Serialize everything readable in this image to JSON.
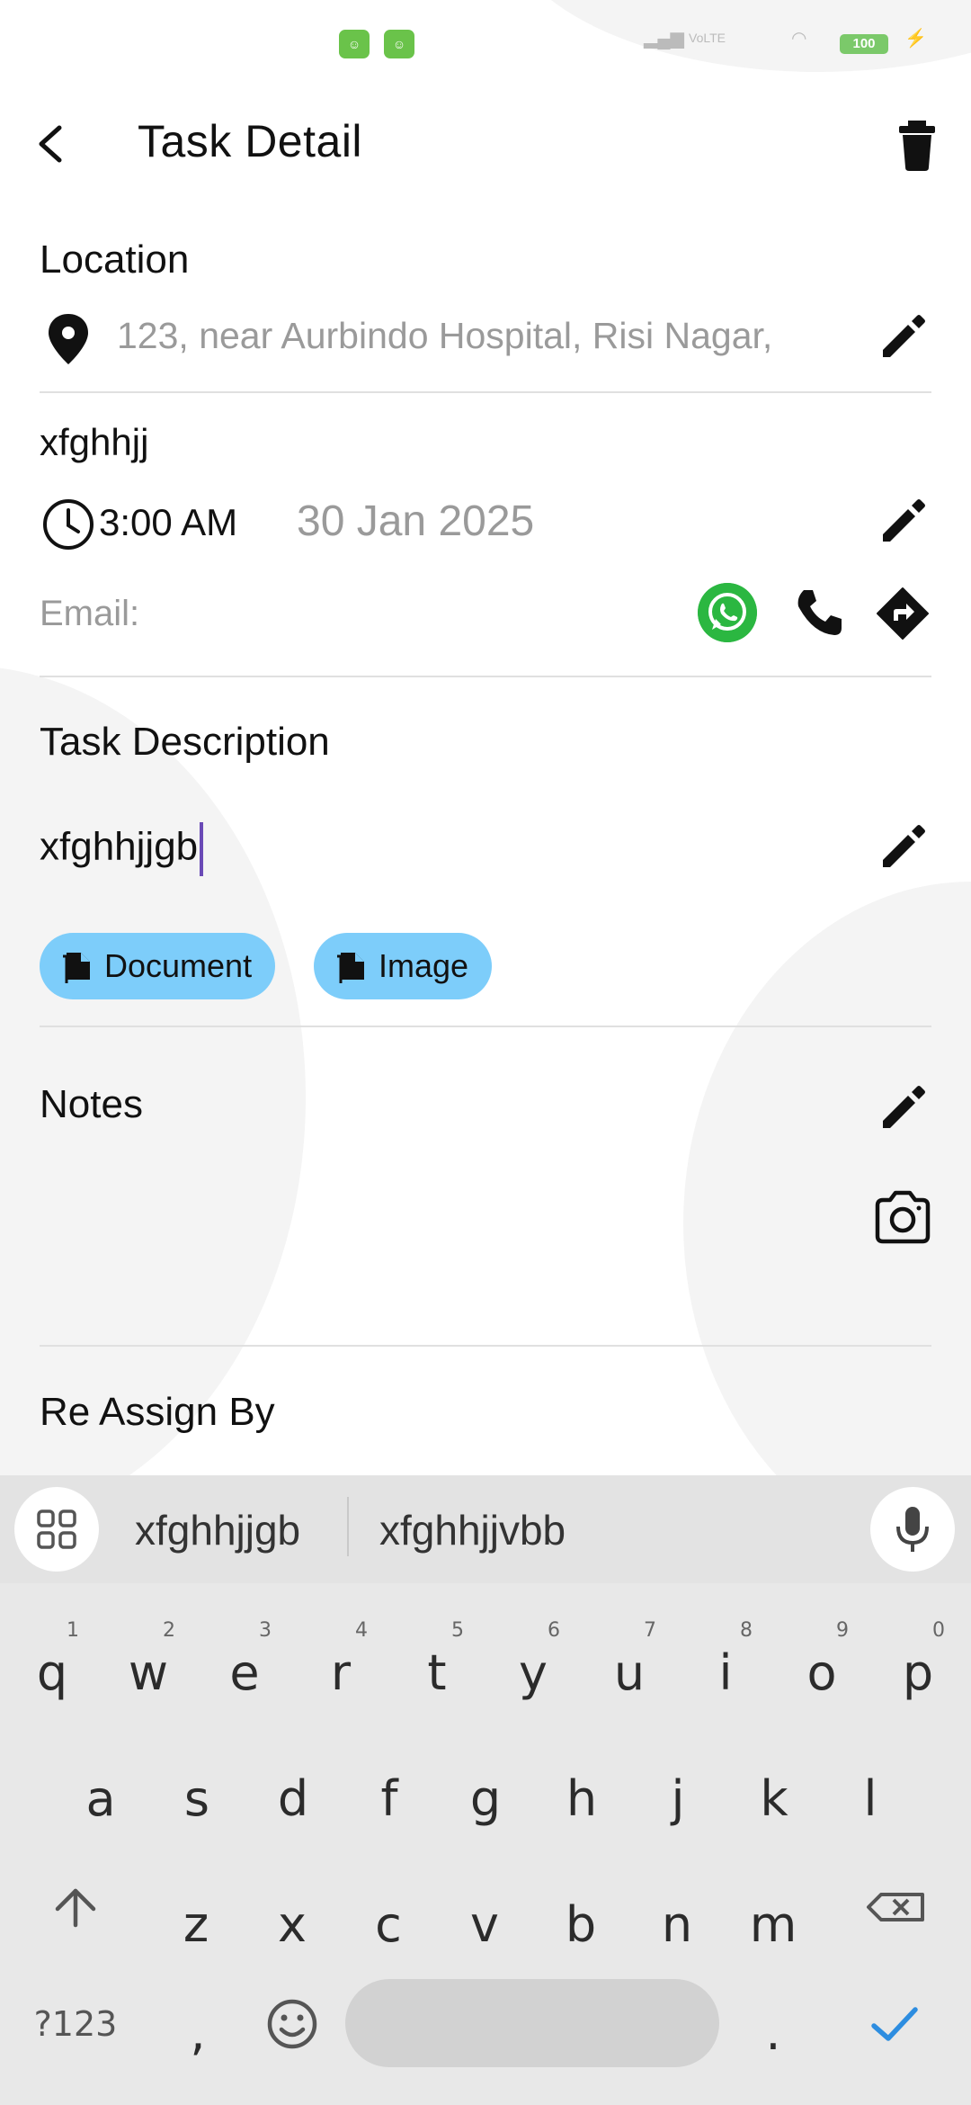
{
  "status_bar": {
    "battery": "100",
    "network": "VoLTE"
  },
  "app_bar": {
    "title": "Task Detail"
  },
  "location": {
    "heading": "Location",
    "address": "123, near Aurbindo Hospital, Risi Nagar,"
  },
  "task": {
    "client": "xfghhjj",
    "time": "3:00 AM",
    "date": "30 Jan 2025",
    "email_label": "Email:"
  },
  "description": {
    "heading": "Task Description",
    "value": "xfghhjjgb",
    "chips": [
      "Document",
      "Image"
    ]
  },
  "notes": {
    "heading": "Notes"
  },
  "reassign": {
    "heading": "Re Assign By"
  },
  "keyboard": {
    "suggestions": [
      "xfghhjjgb",
      "xfghhjjvbb"
    ],
    "row1": [
      "q",
      "w",
      "e",
      "r",
      "t",
      "y",
      "u",
      "i",
      "o",
      "p"
    ],
    "row1_hints": [
      "1",
      "2",
      "3",
      "4",
      "5",
      "6",
      "7",
      "8",
      "9",
      "0"
    ],
    "row2": [
      "a",
      "s",
      "d",
      "f",
      "g",
      "h",
      "j",
      "k",
      "l"
    ],
    "row3": [
      "z",
      "x",
      "c",
      "v",
      "b",
      "n",
      "m"
    ],
    "bottom": {
      "symbols": "?123",
      "comma": ",",
      "period": "."
    }
  },
  "colors": {
    "chip": "#7dcdfa",
    "whatsapp": "#2bb741",
    "cursor": "#6a4ab6",
    "confirm": "#2d8de0"
  },
  "icons": [
    "back-arrow-icon",
    "trash-icon",
    "location-pin-icon",
    "edit-icon",
    "clock-icon",
    "whatsapp-icon",
    "phone-icon",
    "directions-icon",
    "file-icon",
    "camera-icon",
    "grid-icon",
    "mic-icon",
    "shift-icon",
    "backspace-icon",
    "emoji-icon",
    "check-icon"
  ]
}
